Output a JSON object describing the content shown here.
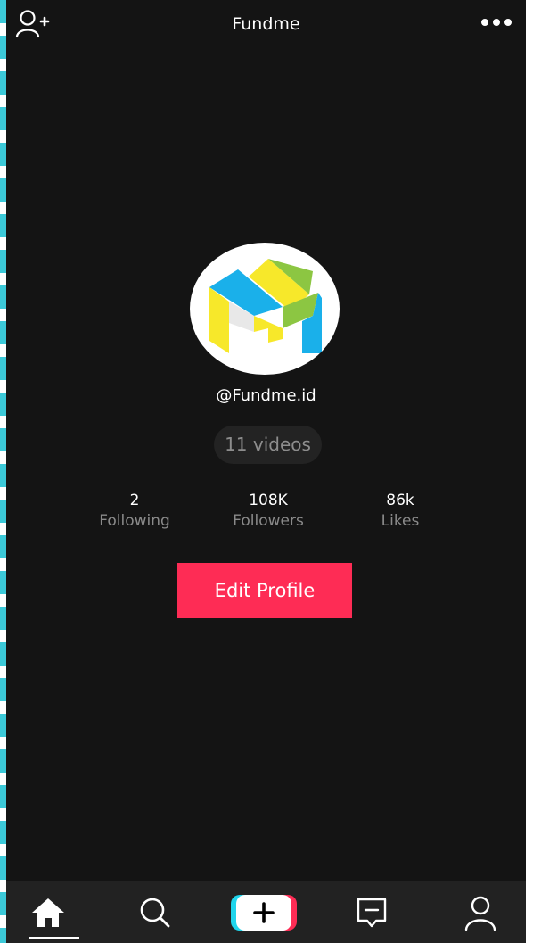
{
  "header": {
    "title": "Fundme",
    "add_user_icon": "add-user-icon",
    "more_icon": "more-horizontal-icon"
  },
  "profile": {
    "avatar_icon": "fundme-logo",
    "handle": "@Fundme.id",
    "videos_label": "11 videos"
  },
  "stats": [
    {
      "value": "2",
      "label": "Following"
    },
    {
      "value": "108K",
      "label": "Followers"
    },
    {
      "value": "86k",
      "label": "Likes"
    }
  ],
  "actions": {
    "edit_profile_label": "Edit Profile"
  },
  "bottom_nav": {
    "items": [
      {
        "icon": "home-icon",
        "active": true
      },
      {
        "icon": "search-icon",
        "active": false
      },
      {
        "icon": "create-plus-icon",
        "active": false
      },
      {
        "icon": "inbox-message-icon",
        "active": false
      },
      {
        "icon": "profile-icon",
        "active": false
      }
    ]
  },
  "colors": {
    "background": "#141414",
    "accent": "#fe2c55",
    "nav_background": "#222222",
    "text_primary": "#ffffff",
    "text_secondary": "#8a8a8a",
    "create_left": "#20d5ec",
    "create_right": "#fe2c55",
    "logo_blue": "#1ab0ea",
    "logo_yellow": "#f7e82a",
    "logo_green": "#8cc642"
  }
}
